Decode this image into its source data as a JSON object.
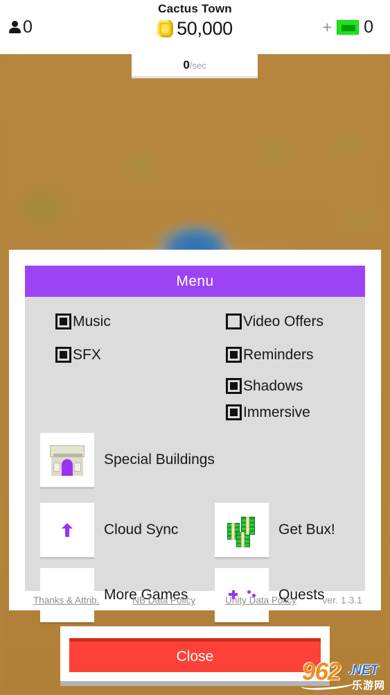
{
  "topbar": {
    "population_icon": "person-icon",
    "population_count": "0",
    "town_title": "Cactus Town",
    "coin_icon": "gold-coin-icon",
    "coin_amount": "50,000",
    "plus_label": "+",
    "bux_icon": "green-cash-icon",
    "bux_count": "0",
    "per_sec_value": "0",
    "per_sec_unit": "/sec"
  },
  "menu": {
    "header_title": "Menu",
    "toggles": [
      {
        "label": "Music",
        "checked": true
      },
      {
        "label": "SFX",
        "checked": true
      },
      {
        "label": "Video Offers",
        "checked": false
      },
      {
        "label": "Reminders",
        "checked": true
      },
      {
        "label": "Shadows",
        "checked": true
      },
      {
        "label": "Immersive",
        "checked": true
      }
    ],
    "buttons": [
      {
        "label": "Special Buildings",
        "icon": "arc-monument-icon"
      },
      {
        "label": "Cloud Sync",
        "icon": "cloud-upload-icon"
      },
      {
        "label": "Get Bux!",
        "icon": "money-stacks-icon"
      },
      {
        "label": "More Games",
        "icon": "joystick-icon"
      },
      {
        "label": "Quests",
        "icon": "gamepad-icon"
      }
    ],
    "footer": {
      "link_thanks": "Thanks & Attrib.",
      "link_nb_policy": "NB Data Policy",
      "link_unity_policy": "Unity Data Policy",
      "version": "ver. 1.3.1"
    }
  },
  "close_card": {
    "close_label": "Close"
  },
  "watermark": {
    "number": "962",
    "domain": ".NET",
    "chinese": "乐游网"
  },
  "colors": {
    "accent_purple": "#9c44f4",
    "icon_purple": "#9c33f2",
    "close_red": "#fc4238",
    "close_red_dark": "#d32a1f",
    "panel_gray": "#dcdcdc",
    "background_sand": "#b5853d",
    "bux_green": "#1ae61a"
  }
}
